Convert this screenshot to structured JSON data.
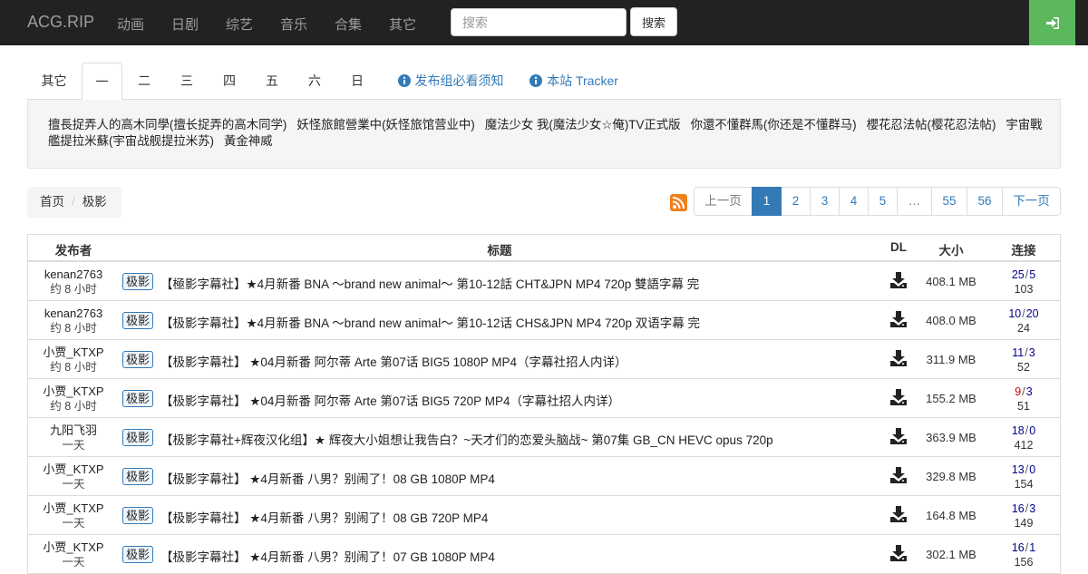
{
  "navbar": {
    "brand": "ACG.RIP",
    "items": [
      "动画",
      "日剧",
      "综艺",
      "音乐",
      "合集",
      "其它"
    ],
    "search_placeholder": "搜索",
    "search_button": "搜索",
    "login_icon": "sign-in-icon"
  },
  "tabs": {
    "items": [
      "其它",
      "一",
      "二",
      "三",
      "四",
      "五",
      "六",
      "日"
    ],
    "active": "一",
    "links": [
      "发布组必看须知",
      "本站 Tracker"
    ]
  },
  "well": {
    "shows": [
      "擅長捉弄人的高木同學(擅长捉弄的高木同学)",
      "妖怪旅館營業中(妖怪旅馆营业中)",
      "魔法少女 我(魔法少女☆俺)TV正式版",
      "你還不懂群馬(你还是不懂群马)",
      "櫻花忍法帖(樱花忍法帖)",
      "宇宙戰艦提拉米蘇(宇宙战舰提拉米苏)",
      "黃金神威"
    ]
  },
  "breadcrumb": {
    "home": "首页",
    "current": "极影"
  },
  "pagination": {
    "prev": "上一页",
    "pages": [
      "1",
      "2",
      "3",
      "4",
      "5",
      "…",
      "55",
      "56"
    ],
    "active": "1",
    "next": "下一页",
    "rss_icon": "rss-icon"
  },
  "table": {
    "headers": {
      "publisher": "发布者",
      "title": "标题",
      "dl": "DL",
      "size": "大小",
      "conn": "连接"
    },
    "rows": [
      {
        "publisher": "kenan2763",
        "time": "约 8 小时",
        "tag": "极影",
        "title": "【極影字幕社】★4月新番 BNA ～brand new animal～ 第10-12話 CHT&JPN MP4 720p 雙語字幕 完",
        "size": "408.1 MB",
        "seed": "25",
        "leech": "5",
        "done": "103",
        "seed_low": false
      },
      {
        "publisher": "kenan2763",
        "time": "约 8 小时",
        "tag": "极影",
        "title": "【极影字幕社】★4月新番 BNA ～brand new animal～ 第10-12话 CHS&JPN MP4 720p 双语字幕 完",
        "size": "408.0 MB",
        "seed": "10",
        "leech": "20",
        "done": "24",
        "seed_low": false
      },
      {
        "publisher": "小贾_KTXP",
        "time": "约 8 小时",
        "tag": "极影",
        "title": "【极影字幕社】 ★04月新番 阿尔蒂 Arte 第07话 BIG5 1080P MP4（字幕社招人内详）",
        "size": "311.9 MB",
        "seed": "11",
        "leech": "3",
        "done": "52",
        "seed_low": false
      },
      {
        "publisher": "小贾_KTXP",
        "time": "约 8 小时",
        "tag": "极影",
        "title": "【极影字幕社】 ★04月新番 阿尔蒂 Arte 第07话 BIG5 720P MP4（字幕社招人内详）",
        "size": "155.2 MB",
        "seed": "9",
        "leech": "3",
        "done": "51",
        "seed_low": true
      },
      {
        "publisher": "九阳飞羽",
        "time": "一天",
        "tag": "极影",
        "title": "【极影字幕社+辉夜汉化组】★ 辉夜大小姐想让我告白？~天才们的恋爱头脑战~ 第07集 GB_CN HEVC opus 720p",
        "size": "363.9 MB",
        "seed": "18",
        "leech": "0",
        "done": "412",
        "seed_low": false
      },
      {
        "publisher": "小贾_KTXP",
        "time": "一天",
        "tag": "极影",
        "title": "【极影字幕社】 ★4月新番 八男？别闹了！08 GB 1080P MP4",
        "size": "329.8 MB",
        "seed": "13",
        "leech": "0",
        "done": "154",
        "seed_low": false
      },
      {
        "publisher": "小贾_KTXP",
        "time": "一天",
        "tag": "极影",
        "title": "【极影字幕社】 ★4月新番 八男？别闹了！08 GB 720P MP4",
        "size": "164.8 MB",
        "seed": "16",
        "leech": "3",
        "done": "149",
        "seed_low": false
      },
      {
        "publisher": "小贾_KTXP",
        "time": "一天",
        "tag": "极影",
        "title": "【极影字幕社】 ★4月新番 八男？别闹了！07 GB 1080P MP4",
        "size": "302.1 MB",
        "seed": "16",
        "leech": "1",
        "done": "156",
        "seed_low": false
      }
    ]
  }
}
